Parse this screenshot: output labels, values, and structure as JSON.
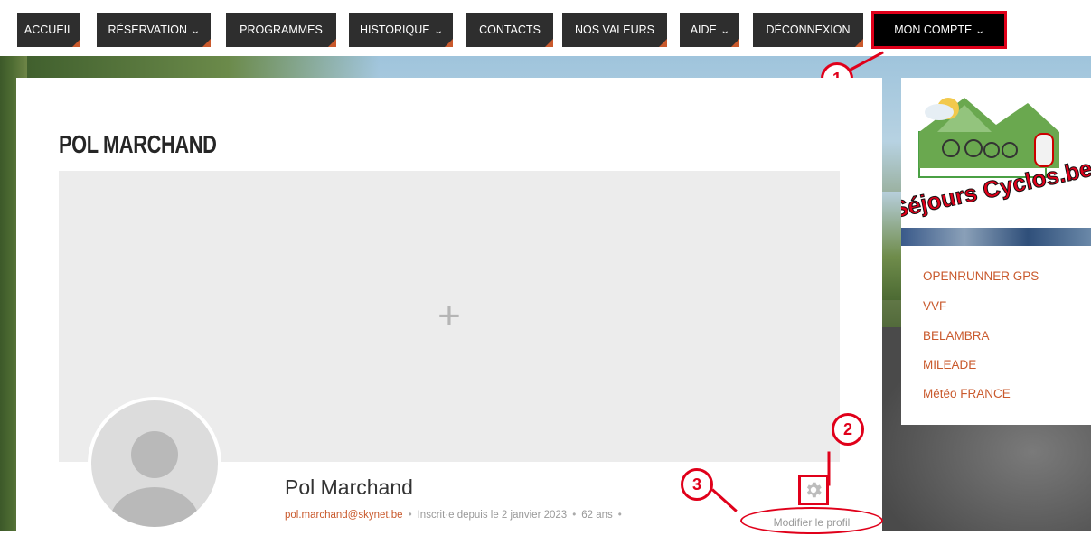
{
  "nav": {
    "items": [
      {
        "label": "ACCUEIL",
        "chevron": false
      },
      {
        "label": "RÉSERVATION",
        "chevron": true
      },
      {
        "label": "PROGRAMMES",
        "chevron": false
      },
      {
        "label": "HISTORIQUE",
        "chevron": true
      },
      {
        "label": "CONTACTS",
        "chevron": false
      },
      {
        "label": "NOS VALEURS",
        "chevron": false
      },
      {
        "label": "AIDE",
        "chevron": true
      },
      {
        "label": "DÉCONNEXION",
        "chevron": false
      },
      {
        "label": "MON COMPTE",
        "chevron": true
      }
    ],
    "chevron_glyph": "⌄"
  },
  "profile": {
    "page_title": "POL MARCHAND",
    "cover_plus": "+",
    "name": "Pol Marchand",
    "email": "pol.marchand@skynet.be",
    "separator": "•",
    "since": "Inscrit·e depuis le 2 janvier 2023",
    "age": "62 ans",
    "edit_label": "Modifier le profil"
  },
  "annotations": {
    "c1": "1",
    "c2": "2",
    "c3": "3"
  },
  "sidebar": {
    "logo_text": "Séjours Cyclos.be",
    "links": [
      "OPENRUNNER GPS",
      "VVF",
      "BELAMBRA",
      "MILEADE",
      "Météo FRANCE"
    ]
  },
  "colors": {
    "accent": "#c9592c",
    "annotation": "#e0001a",
    "nav_bg": "#2e2e2e"
  }
}
